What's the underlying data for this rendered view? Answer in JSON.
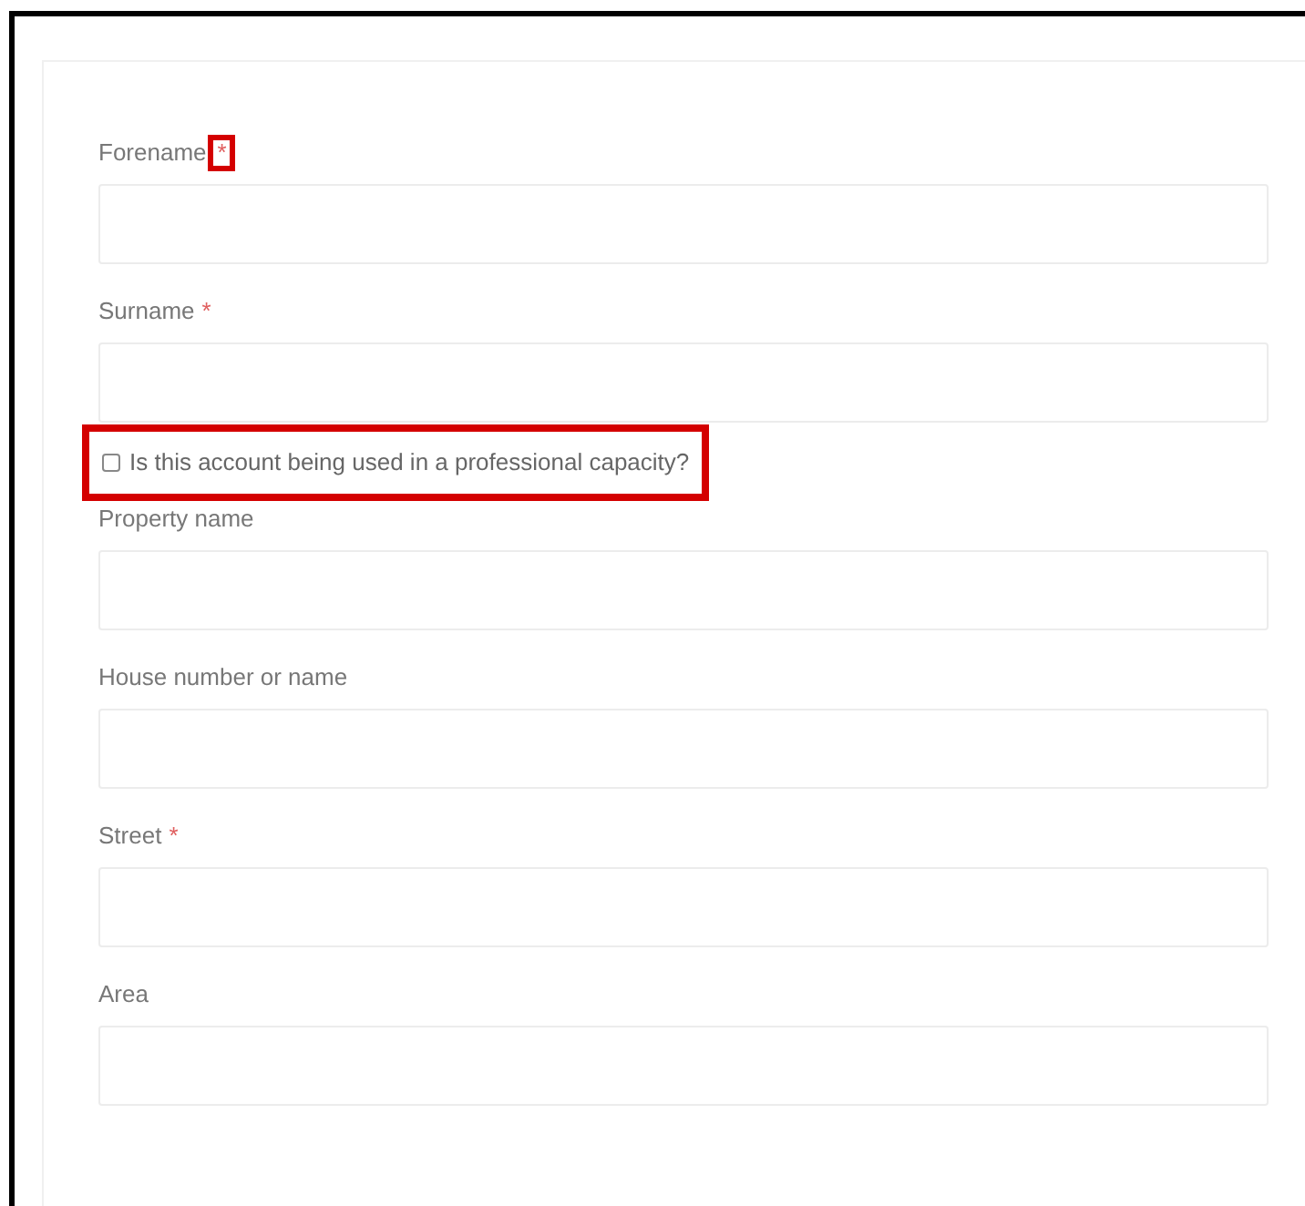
{
  "form": {
    "items": [
      {
        "kind": "field",
        "label": "Forename",
        "required_mark": "*",
        "highlighted": true
      },
      {
        "kind": "field",
        "label": "Surname",
        "required_mark": "*"
      },
      {
        "kind": "checkbox",
        "label": "Is this account being used in a professional capacity?",
        "checked": false,
        "highlighted": true
      },
      {
        "kind": "field",
        "label": "Property name"
      },
      {
        "kind": "field",
        "label": "House number or name"
      },
      {
        "kind": "field",
        "label": "Street",
        "required_mark": "*"
      },
      {
        "kind": "field",
        "label": "Area"
      }
    ]
  }
}
